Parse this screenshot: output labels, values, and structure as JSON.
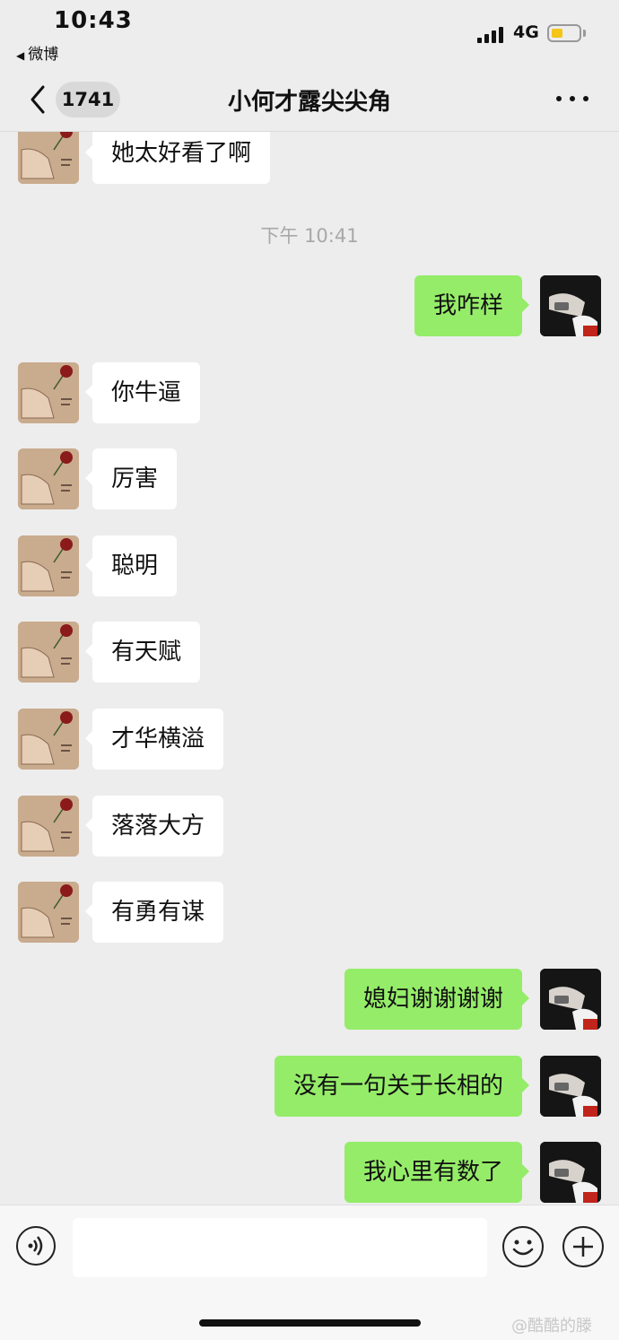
{
  "status_bar": {
    "time": "10:43",
    "back_app": "微博",
    "network": "4G"
  },
  "nav": {
    "back_count": "1741",
    "title": "小何才露尖尖角"
  },
  "timestamp": "下午 10:41",
  "messages": [
    {
      "side": "left",
      "text": "她太好看了啊"
    },
    {
      "side": "right",
      "text": "我咋样"
    },
    {
      "side": "left",
      "text": "你牛逼"
    },
    {
      "side": "left",
      "text": "厉害"
    },
    {
      "side": "left",
      "text": "聪明"
    },
    {
      "side": "left",
      "text": "有天赋"
    },
    {
      "side": "left",
      "text": "才华横溢"
    },
    {
      "side": "left",
      "text": "落落大方"
    },
    {
      "side": "left",
      "text": "有勇有谋"
    },
    {
      "side": "right",
      "text": "媳妇谢谢谢谢"
    },
    {
      "side": "right",
      "text": "没有一句关于长相的"
    },
    {
      "side": "right",
      "text": "我心里有数了"
    }
  ],
  "input": {
    "value": "",
    "placeholder": ""
  },
  "watermark": "@酷酷的滕",
  "colors": {
    "sent_bubble": "#95ec69",
    "received_bubble": "#ffffff",
    "background": "#ededed"
  },
  "icons": [
    "back-chevron-icon",
    "more-icon",
    "voice-icon",
    "emoji-icon",
    "plus-icon"
  ]
}
